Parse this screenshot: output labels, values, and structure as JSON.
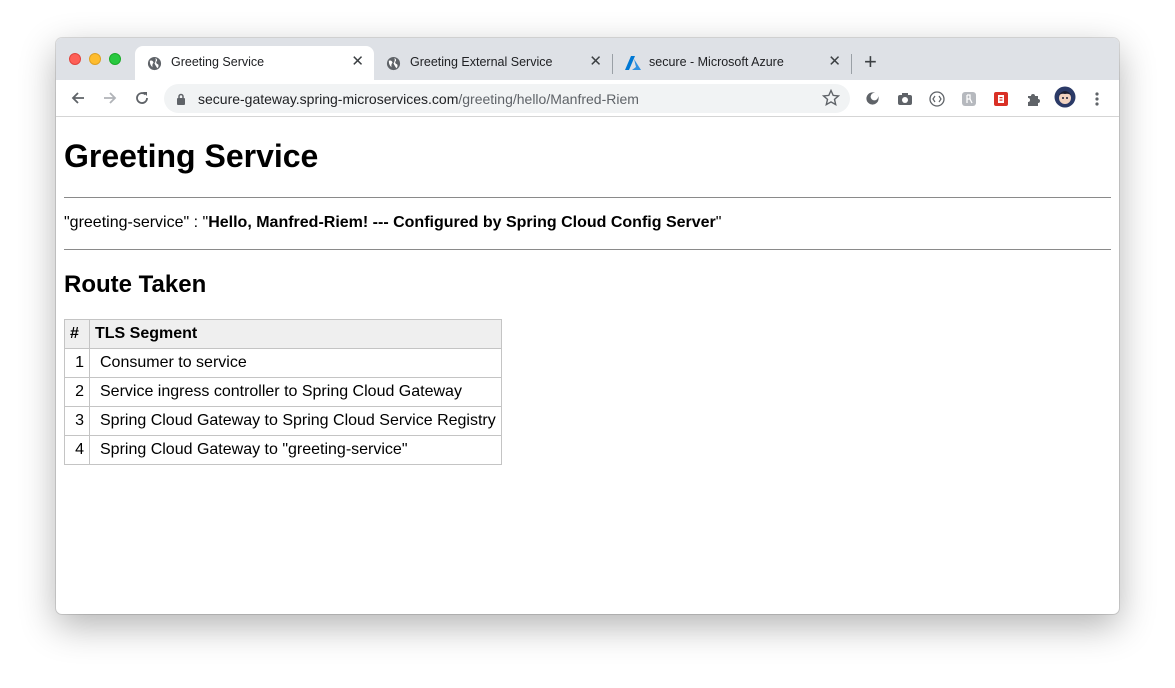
{
  "browser": {
    "tabs": [
      {
        "title": "Greeting Service",
        "active": true,
        "icon": "globe-icon"
      },
      {
        "title": "Greeting External Service",
        "active": false,
        "icon": "globe-icon"
      },
      {
        "title": "secure - Microsoft Azure",
        "active": false,
        "icon": "azure-icon"
      }
    ],
    "close_glyph": "✕",
    "new_tab_glyph": "+",
    "url_host": "secure-gateway.spring-microservices.com",
    "url_path": "/greeting/hello/Manfred-Riem",
    "colors": {
      "azure": "#0078d4",
      "tabstrip": "#dee1e6",
      "omnibox": "#f1f3f4"
    }
  },
  "page": {
    "title": "Greeting Service",
    "result_key": "\"greeting-service\" : \"",
    "result_value": "Hello, Manfred-Riem! --- Configured by Spring Cloud Config Server",
    "result_end": "\"",
    "route_heading": "Route Taken",
    "table": {
      "headers": [
        "#",
        "TLS Segment"
      ],
      "rows": [
        {
          "num": "1",
          "segment": "Consumer to service"
        },
        {
          "num": "2",
          "segment": "Service ingress controller to Spring Cloud Gateway"
        },
        {
          "num": "3",
          "segment": "Spring Cloud Gateway to Spring Cloud Service Registry"
        },
        {
          "num": "4",
          "segment": "Spring Cloud Gateway to \"greeting-service\""
        }
      ]
    }
  }
}
